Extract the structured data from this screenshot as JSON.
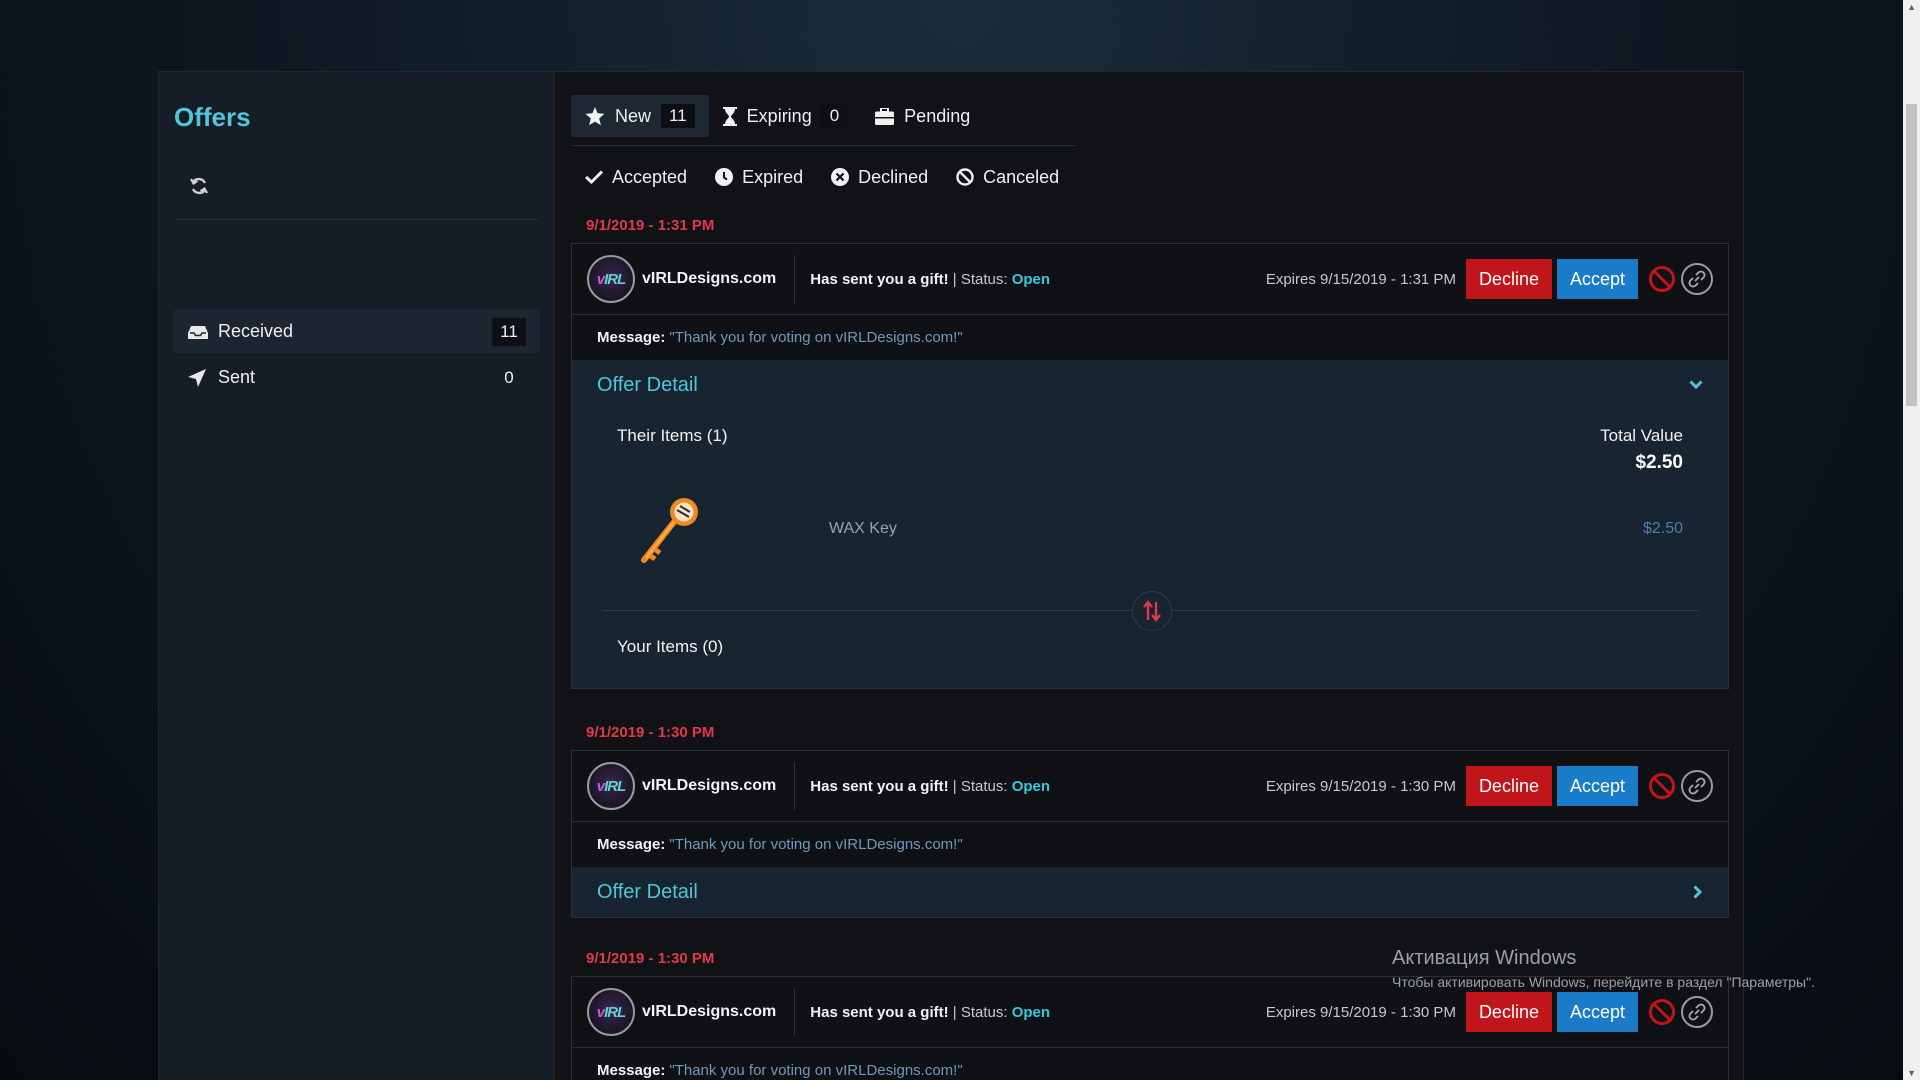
{
  "sidebar": {
    "title": "Offers",
    "items": [
      {
        "label": "Received",
        "count": "11"
      },
      {
        "label": "Sent",
        "count": "0"
      }
    ]
  },
  "tabs": {
    "primary": [
      {
        "label": "New",
        "count": "11"
      },
      {
        "label": "Expiring",
        "count": "0"
      },
      {
        "label": "Pending"
      }
    ],
    "secondary": [
      {
        "label": "Accepted"
      },
      {
        "label": "Expired"
      },
      {
        "label": "Declined"
      },
      {
        "label": "Canceled"
      }
    ]
  },
  "offers": [
    {
      "date": "9/1/2019 - 1:31 PM",
      "sender": "vIRLDesigns.com",
      "gift_text": "Has sent you a gift!",
      "status_sep": " | ",
      "status_label": "Status: ",
      "status": "Open",
      "expires": "Expires 9/15/2019 - 1:31 PM",
      "decline": "Decline",
      "accept": "Accept",
      "message_label": "Message:",
      "message": "\"Thank you for voting on vIRLDesigns.com!\"",
      "detail_title": "Offer Detail",
      "their_items": "Their Items (1)",
      "total_label": "Total Value",
      "total_value": "$2.50",
      "item_name": "WAX Key",
      "item_price": "$2.50",
      "your_items": "Your Items (0)"
    },
    {
      "date": "9/1/2019 - 1:30 PM",
      "sender": "vIRLDesigns.com",
      "gift_text": "Has sent you a gift!",
      "status_sep": " | ",
      "status_label": "Status: ",
      "status": "Open",
      "expires": "Expires 9/15/2019 - 1:30 PM",
      "decline": "Decline",
      "accept": "Accept",
      "message_label": "Message:",
      "message": "\"Thank you for voting on vIRLDesigns.com!\"",
      "detail_title": "Offer Detail"
    },
    {
      "date": "9/1/2019 - 1:30 PM",
      "sender": "vIRLDesigns.com",
      "gift_text": "Has sent you a gift!",
      "status_sep": " | ",
      "status_label": "Status: ",
      "status": "Open",
      "expires": "Expires 9/15/2019 - 1:30 PM",
      "decline": "Decline",
      "accept": "Accept",
      "message_label": "Message:",
      "message": "\"Thank you for voting on vIRLDesigns.com!\""
    }
  ],
  "avatar_text": {
    "v": "v",
    "irl": "IRL"
  },
  "watermark": {
    "line1": "Активация Windows",
    "line2": "Чтобы активировать Windows, перейдите в раздел \"Параметры\"."
  },
  "colors": {
    "accent": "#4fc6d9",
    "date": "#e03a4a",
    "decline": "#c0161b",
    "accept": "#1a7cc8",
    "status_open": "#35c9e0"
  },
  "icons": [
    "refresh-icon",
    "inbox-icon",
    "send-icon",
    "star-icon",
    "hourglass-icon",
    "briefcase-icon",
    "check-icon",
    "clock-icon",
    "x-circle-icon",
    "ban-icon",
    "link-icon",
    "chevron-down-icon",
    "chevron-right-icon",
    "key-icon",
    "swap-icon"
  ]
}
